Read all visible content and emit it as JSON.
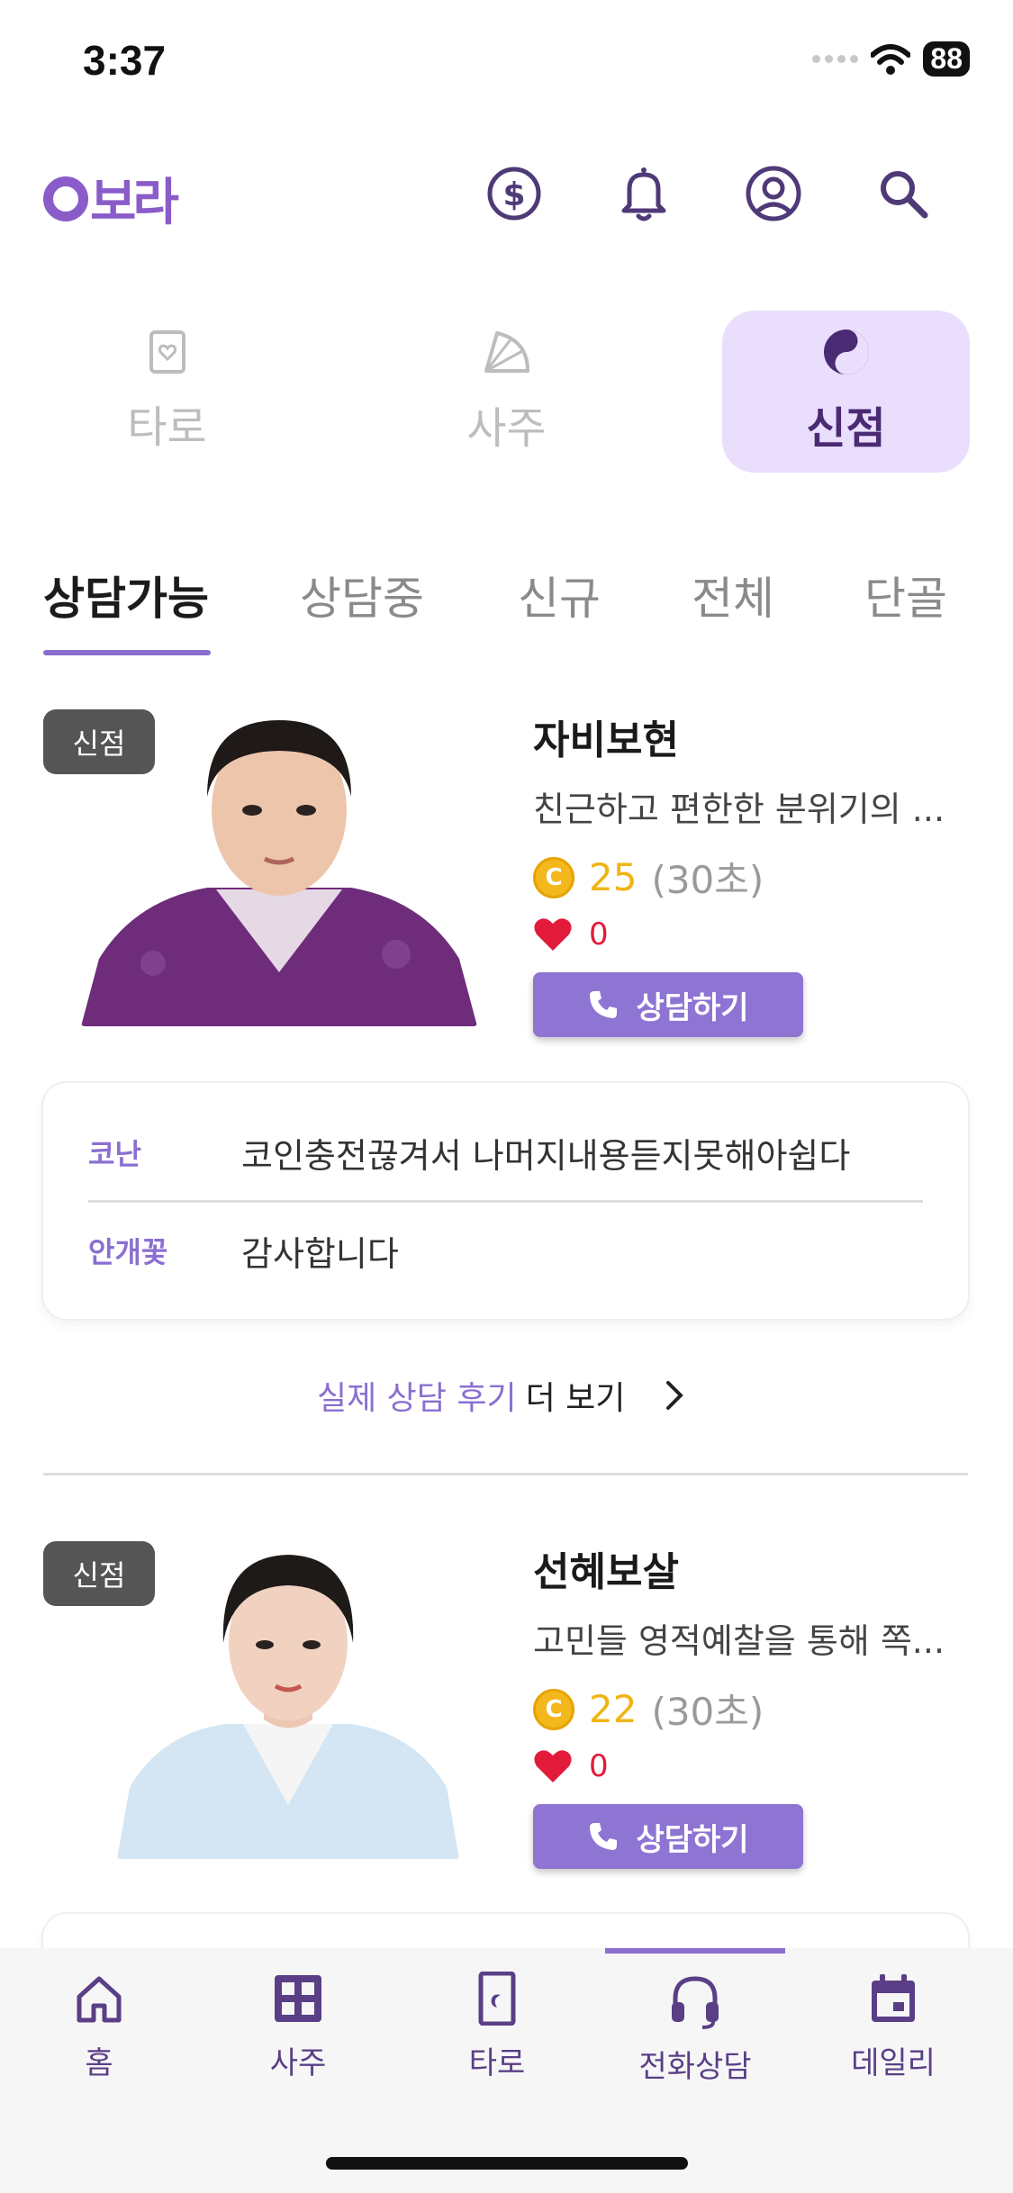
{
  "status": {
    "time": "3:37",
    "battery": "88"
  },
  "header": {
    "logo_text": "보라",
    "icons": [
      "coin-icon",
      "bell-icon",
      "profile-icon",
      "search-icon"
    ]
  },
  "categories": [
    {
      "label": "타로",
      "icon": "tarot-card-icon",
      "active": false
    },
    {
      "label": "사주",
      "icon": "fan-icon",
      "active": false
    },
    {
      "label": "신점",
      "icon": "yin-yang-icon",
      "active": true
    }
  ],
  "tabs": [
    {
      "label": "상담가능",
      "active": true
    },
    {
      "label": "상담중",
      "active": false
    },
    {
      "label": "신규",
      "active": false
    },
    {
      "label": "전체",
      "active": false
    },
    {
      "label": "단골",
      "active": false
    }
  ],
  "counselors": [
    {
      "badge": "신점",
      "name": "자비보현",
      "description": "친근하고 편한한 분위기의 ...",
      "price": "25",
      "unit": "(30초)",
      "likes": "0",
      "button_label": "상담하기",
      "reviews": [
        {
          "author": "코난",
          "text": "코인충전끊겨서 나머지내용듣지못해아쉽다"
        },
        {
          "author": "안개꽃",
          "text": "감사합니다"
        }
      ],
      "more": {
        "highlight": "실제 상담 후기",
        "rest": "더 보기"
      }
    },
    {
      "badge": "신점",
      "name": "선혜보살",
      "description": "고민들 영적예찰을 통해 쪽...",
      "price": "22",
      "unit": "(30초)",
      "likes": "0",
      "button_label": "상담하기"
    }
  ],
  "bottom_nav": [
    {
      "label": "홈",
      "icon": "home-icon"
    },
    {
      "label": "사주",
      "icon": "grid-icon"
    },
    {
      "label": "타로",
      "icon": "tarot-moon-icon"
    },
    {
      "label": "전화상담",
      "icon": "headset-icon",
      "active": true
    },
    {
      "label": "데일리",
      "icon": "calendar-icon"
    }
  ],
  "colors": {
    "accent": "#8a6fd0",
    "brand": "#8a5cc9",
    "coin": "#f0b413",
    "heart": "#e21b3a"
  }
}
